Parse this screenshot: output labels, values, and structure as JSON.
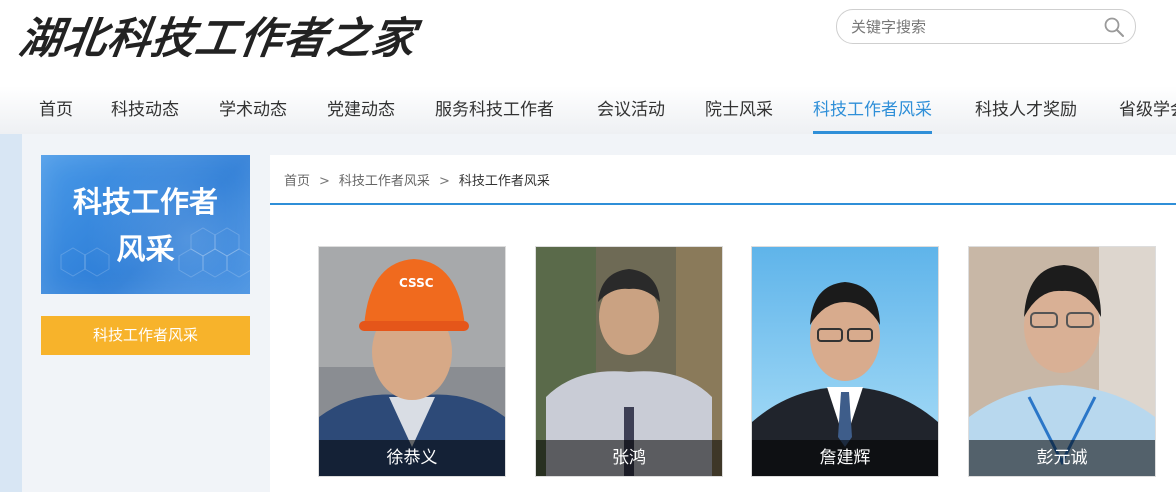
{
  "site": {
    "logo_text": "湖北科技工作者之家"
  },
  "search": {
    "placeholder": "关键字搜索"
  },
  "nav": {
    "items": [
      {
        "label": "首页"
      },
      {
        "label": "科技动态"
      },
      {
        "label": "学术动态"
      },
      {
        "label": "党建动态"
      },
      {
        "label": "服务科技工作者"
      },
      {
        "label": "会议活动"
      },
      {
        "label": "院士风采"
      },
      {
        "label": "科技工作者风采"
      },
      {
        "label": "科技人才奖励"
      },
      {
        "label": "省级学会"
      }
    ],
    "active_label": "科技工作者风采"
  },
  "sidebar": {
    "banner_line1": "科技工作者",
    "banner_line2": "风采",
    "button_label": "科技工作者风采"
  },
  "breadcrumb": {
    "home": "首页",
    "separator": ">",
    "level1": "科技工作者风采",
    "current": "科技工作者风采"
  },
  "people": [
    {
      "name": "徐恭义",
      "helmet_text": "CSSC"
    },
    {
      "name": "张鸿"
    },
    {
      "name": "詹建辉"
    },
    {
      "name": "彭元诚"
    }
  ],
  "colors": {
    "accent": "#2f8fd8",
    "button_orange": "#f7b32b",
    "banner_blue": "#2a7bd6"
  }
}
